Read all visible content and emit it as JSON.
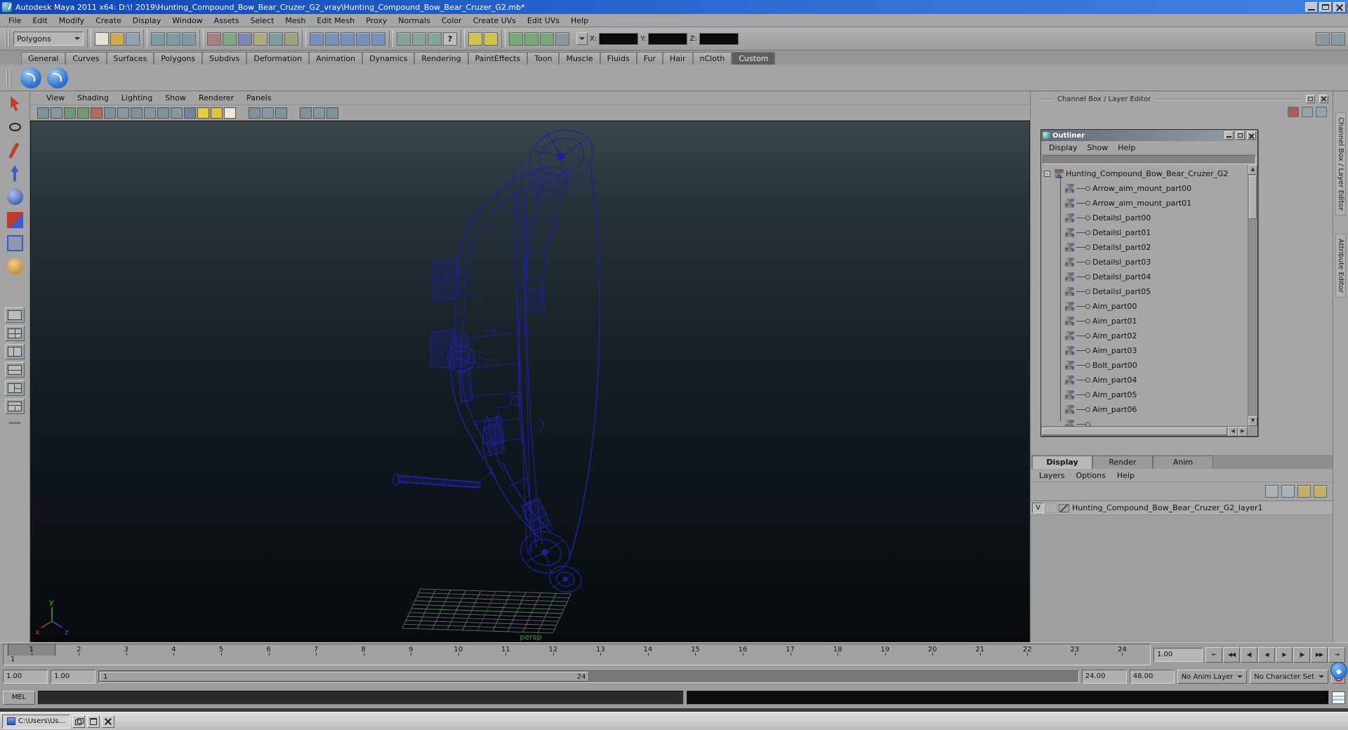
{
  "titlebar": {
    "title": "Autodesk Maya 2011 x64: D:\\! 2019\\Hunting_Compound_Bow_Bear_Cruzer_G2_vray\\Hunting_Compound_Bow_Bear_Cruzer_G2.mb*"
  },
  "menubar": {
    "items": [
      "File",
      "Edit",
      "Modify",
      "Create",
      "Display",
      "Window",
      "Assets",
      "Select",
      "Mesh",
      "Edit Mesh",
      "Proxy",
      "Normals",
      "Color",
      "Create UVs",
      "Edit UVs",
      "Help"
    ]
  },
  "statusline": {
    "mode": "Polygons",
    "file_icons": [
      {
        "n": "new-scene-icon",
        "c": "#e4e0d4"
      },
      {
        "n": "open-scene-icon",
        "c": "#cfa94e"
      },
      {
        "n": "save-scene-icon",
        "c": "#8fa6b2"
      }
    ],
    "mode_icons": [
      {
        "n": "select-hierarchy-icon",
        "c": "#7e9aa2"
      },
      {
        "n": "select-object-icon",
        "c": "#7e9aa2"
      },
      {
        "n": "select-component-icon",
        "c": "#7e9aa2"
      }
    ],
    "mask_icons": [
      {
        "n": "highlight-mask-icon",
        "c": "#a87e7e"
      },
      {
        "n": "handles-mask-icon",
        "c": "#7ea87e"
      },
      {
        "n": "joints-mask-icon",
        "c": "#7e86b2"
      },
      {
        "n": "curves-mask-icon",
        "c": "#b2a87e"
      },
      {
        "n": "surfaces-mask-icon",
        "c": "#7e9aa2"
      },
      {
        "n": "deformers-mask-icon",
        "c": "#9aa27e"
      }
    ],
    "snap_icons": [
      {
        "n": "snap-to-grid-icon",
        "c": "#7792c0"
      },
      {
        "n": "snap-to-curve-icon",
        "c": "#7792c0"
      },
      {
        "n": "snap-to-point-icon",
        "c": "#7792c0"
      },
      {
        "n": "snap-to-view-plane-icon",
        "c": "#7792c0"
      },
      {
        "n": "snap-to-surface-icon",
        "c": "#7792c0"
      }
    ],
    "history_icons": [
      {
        "n": "input-to-selected-icon",
        "c": "#86a49c"
      },
      {
        "n": "output-of-selected-icon",
        "c": "#86a49c"
      },
      {
        "n": "construction-history-icon",
        "c": "#86a49c"
      }
    ],
    "help_glyph": "?",
    "key_icons": [
      {
        "n": "keyframe-lock-icon",
        "c": "#d2c24e"
      },
      {
        "n": "keyframe-icon",
        "c": "#d2c24e"
      }
    ],
    "render_icons": [
      {
        "n": "open-render-view-icon",
        "c": "#79a879"
      },
      {
        "n": "render-current-frame-icon",
        "c": "#79a879"
      },
      {
        "n": "ipr-render-icon",
        "c": "#79a879"
      },
      {
        "n": "render-settings-icon",
        "c": "#8a9aa2"
      }
    ],
    "coord": {
      "x": "X:",
      "y": "Y:",
      "z": "Z:"
    },
    "right_icons": [
      {
        "n": "toggle-channel-box-icon",
        "c": "#8a9aa2"
      },
      {
        "n": "toggle-tool-settings-icon",
        "c": "#8a9aa2"
      }
    ]
  },
  "shelf": {
    "tabs": [
      {
        "label": "General"
      },
      {
        "label": "Curves"
      },
      {
        "label": "Surfaces"
      },
      {
        "label": "Polygons"
      },
      {
        "label": "Subdivs"
      },
      {
        "label": "Deformation"
      },
      {
        "label": "Animation"
      },
      {
        "label": "Dynamics"
      },
      {
        "label": "Rendering"
      },
      {
        "label": "PaintEffects"
      },
      {
        "label": "Toon"
      },
      {
        "label": "Muscle"
      },
      {
        "label": "Fluids"
      },
      {
        "label": "Fur"
      },
      {
        "label": "Hair"
      },
      {
        "label": "nCloth"
      },
      {
        "label": "Custom",
        "active": true
      }
    ],
    "items": [
      {
        "n": "custom-shelf-item-1"
      },
      {
        "n": "custom-shelf-item-2"
      }
    ]
  },
  "toolbox": {
    "tools": [
      {
        "n": "select-tool",
        "cls": "t-select"
      },
      {
        "n": "lasso-select-tool",
        "cls": "t-lasso"
      },
      {
        "n": "paint-selection-tool",
        "cls": "t-paint"
      },
      {
        "n": "move-tool",
        "cls": "t-move"
      },
      {
        "n": "rotate-tool",
        "cls": "t-rotate"
      },
      {
        "n": "scale-tool",
        "cls": "t-scale"
      },
      {
        "n": "universal-manipulator-tool",
        "cls": "t-universal"
      },
      {
        "n": "soft-modification-tool",
        "cls": "t-softmod"
      }
    ],
    "layouts": [
      {
        "n": "single-pane-layout-button",
        "cls": "ls-single"
      },
      {
        "n": "four-pane-layout-button",
        "cls": "ls-four"
      },
      {
        "n": "two-pane-side-layout-button",
        "cls": "ls-twov"
      },
      {
        "n": "two-pane-stacked-layout-button",
        "cls": "ls-twoh"
      },
      {
        "n": "three-pane-left-layout-button",
        "cls": "ls-threel"
      },
      {
        "n": "three-pane-top-layout-button",
        "cls": "ls-threet"
      }
    ]
  },
  "viewport": {
    "menus": [
      "View",
      "Shading",
      "Lighting",
      "Show",
      "Renderer",
      "Panels"
    ],
    "camera_label": "persp",
    "axis": {
      "x": "x",
      "y": "y",
      "z": "z"
    },
    "toolbar_icons": [
      {
        "n": "select-camera-icon",
        "c": "#7e949c"
      },
      {
        "n": "lock-camera-icon",
        "c": "#88989e"
      },
      {
        "n": "grid-icon",
        "c": "#6f9a74"
      },
      {
        "n": "film-gate-icon",
        "c": "#6f9a74"
      },
      {
        "n": "resolution-gate-icon",
        "c": "#b06a5e"
      },
      {
        "n": "gate-mask-icon",
        "c": "#7e949c"
      },
      {
        "n": "field-chart-icon",
        "c": "#88989e"
      },
      {
        "n": "safe-action-icon",
        "c": "#7e949c"
      },
      {
        "n": "safe-title-icon",
        "c": "#88989e"
      },
      {
        "n": "wireframe-icon",
        "c": "#7e949c"
      },
      {
        "n": "shaded-icon",
        "c": "#88989e"
      },
      {
        "n": "textured-icon",
        "c": "#6f86a0"
      },
      {
        "n": "use-all-lights-icon",
        "c": "#e6ce42"
      },
      {
        "n": "shadows-icon",
        "c": "#e0c23a"
      },
      {
        "n": "ambient-occlusion-icon",
        "c": "#ece9d8"
      }
    ],
    "toolbar_icons2": [
      {
        "n": "isolate-select-icon",
        "c": "#7e949c"
      },
      {
        "n": "xray-icon",
        "c": "#88989e"
      },
      {
        "n": "xray-joints-icon",
        "c": "#7e949c"
      }
    ],
    "toolbar_icons3": [
      {
        "n": "exposure-icon",
        "c": "#7e949c"
      },
      {
        "n": "gamma-icon",
        "c": "#88989e"
      },
      {
        "n": "view-transform-icon",
        "c": "#7e949c"
      }
    ]
  },
  "right_panel": {
    "header": "Channel Box / Layer Editor",
    "quick_icons": [
      {
        "n": "snap-align-icon",
        "c": "#b05a5a"
      },
      {
        "n": "render-sphere-icon",
        "c": "#98a2a8"
      },
      {
        "n": "pick-pointer-icon",
        "c": "#98a2a8"
      }
    ],
    "outliner": {
      "title": "Outliner",
      "menus": [
        "Display",
        "Show",
        "Help"
      ],
      "root": {
        "name": "Hunting_Compound_Bow_Bear_Cruzer_G2",
        "expander": "-"
      },
      "children": [
        {
          "name": "Arrow_aim_mount_part00"
        },
        {
          "name": "Arrow_aim_mount_part01"
        },
        {
          "name": "Detailsl_part00"
        },
        {
          "name": "Detailsl_part01"
        },
        {
          "name": "Detailsl_part02"
        },
        {
          "name": "Detailsl_part03"
        },
        {
          "name": "Detailsl_part04"
        },
        {
          "name": "Detailsl_part05"
        },
        {
          "name": "Aim_part00"
        },
        {
          "name": "Aim_part01"
        },
        {
          "name": "Aim_part02"
        },
        {
          "name": "Aim_part03"
        },
        {
          "name": "Bolt_part00"
        },
        {
          "name": "Aim_part04"
        },
        {
          "name": "Aim_part05"
        },
        {
          "name": "Aim_part06"
        }
      ],
      "scroll_up": "▲",
      "scroll_down": "▼",
      "scroll_left": "◀",
      "scroll_right": "▶"
    },
    "layer_editor": {
      "tabs": [
        {
          "label": "Display",
          "active": true
        },
        {
          "label": "Render"
        },
        {
          "label": "Anim"
        }
      ],
      "menus": [
        "Layers",
        "Options",
        "Help"
      ],
      "icons": [
        {
          "n": "new-empty-layer-icon",
          "c": "#a8b2b8"
        },
        {
          "n": "new-layer-from-selected-icon",
          "c": "#a8b2b8"
        },
        {
          "n": "layer-move-up-icon",
          "c": "#c2b06a"
        },
        {
          "n": "layer-move-down-icon",
          "c": "#c2b06a"
        }
      ],
      "layers": [
        {
          "visibility": "V",
          "name": "Hunting_Compound_Bow_Bear_Cruzer_G2_layer1"
        }
      ]
    }
  },
  "side_tabs": [
    {
      "label": "Channel Box / Layer Editor"
    },
    {
      "label": "Attribute Editor"
    }
  ],
  "timeline": {
    "frames": [
      "1",
      "2",
      "3",
      "4",
      "5",
      "6",
      "7",
      "8",
      "9",
      "10",
      "11",
      "12",
      "13",
      "14",
      "15",
      "16",
      "17",
      "18",
      "19",
      "20",
      "21",
      "22",
      "23",
      "24"
    ],
    "current": "1",
    "time_field": "1.00",
    "playback": [
      {
        "n": "go-to-playback-start-button",
        "g": "⇤"
      },
      {
        "n": "step-back-one-key-button",
        "g": "◀◀"
      },
      {
        "n": "step-back-one-frame-button",
        "g": "◀|"
      },
      {
        "n": "play-backwards-button",
        "g": "◀"
      },
      {
        "n": "play-forwards-button",
        "g": "▶"
      },
      {
        "n": "step-forward-one-frame-button",
        "g": "|▶"
      },
      {
        "n": "step-forward-one-key-button",
        "g": "▶▶"
      },
      {
        "n": "go-to-playback-end-button",
        "g": "⇥"
      }
    ]
  },
  "range": {
    "anim_start": "1.00",
    "play_start": "1.00",
    "bar_start": "1",
    "bar_end": "24",
    "play_end": "24.00",
    "anim_end": "48.00",
    "anim_layer": "No Anim Layer",
    "char_set": "No Character Set"
  },
  "command_line": {
    "label": "MEL"
  },
  "taskbar": {
    "window_button": "C:\\Users\\Us..."
  }
}
